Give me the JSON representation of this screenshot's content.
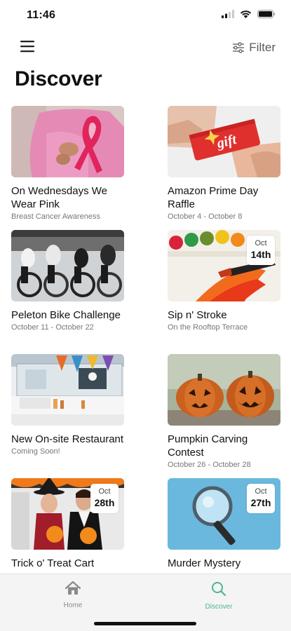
{
  "status_bar": {
    "time": "11:46"
  },
  "header": {
    "filter_label": "Filter",
    "title": "Discover"
  },
  "cards": [
    {
      "title": "On Wednesdays We Wear Pink",
      "subtitle": "Breast Cancer Awareness"
    },
    {
      "title": "Amazon Prime Day Raffle",
      "subtitle": "October 4 - October 8",
      "image_text": "gift"
    },
    {
      "title": "Peleton Bike Challenge",
      "subtitle": "October 11 - October 22"
    },
    {
      "title": "Sip n' Stroke",
      "subtitle": "On the Rooftop Terrace",
      "badge_month": "Oct",
      "badge_day": "14th"
    },
    {
      "title": "New On-site Restaurant",
      "subtitle": "Coming Soon!"
    },
    {
      "title": "Pumpkin Carving Contest",
      "subtitle": "October 26 - October 28"
    },
    {
      "title": "Trick o' Treat Cart",
      "subtitle": "",
      "badge_month": "Oct",
      "badge_day": "28th"
    },
    {
      "title": "Murder Mystery",
      "subtitle": "",
      "badge_month": "Oct",
      "badge_day": "27th"
    }
  ],
  "bottom_nav": {
    "items": [
      {
        "label": "Home",
        "icon": "home-icon",
        "active": false
      },
      {
        "label": "Discover",
        "icon": "search-icon",
        "active": true
      }
    ]
  },
  "colors": {
    "accent": "#4cb592",
    "inactive": "#8a8a8a",
    "background": "#ffffff"
  }
}
